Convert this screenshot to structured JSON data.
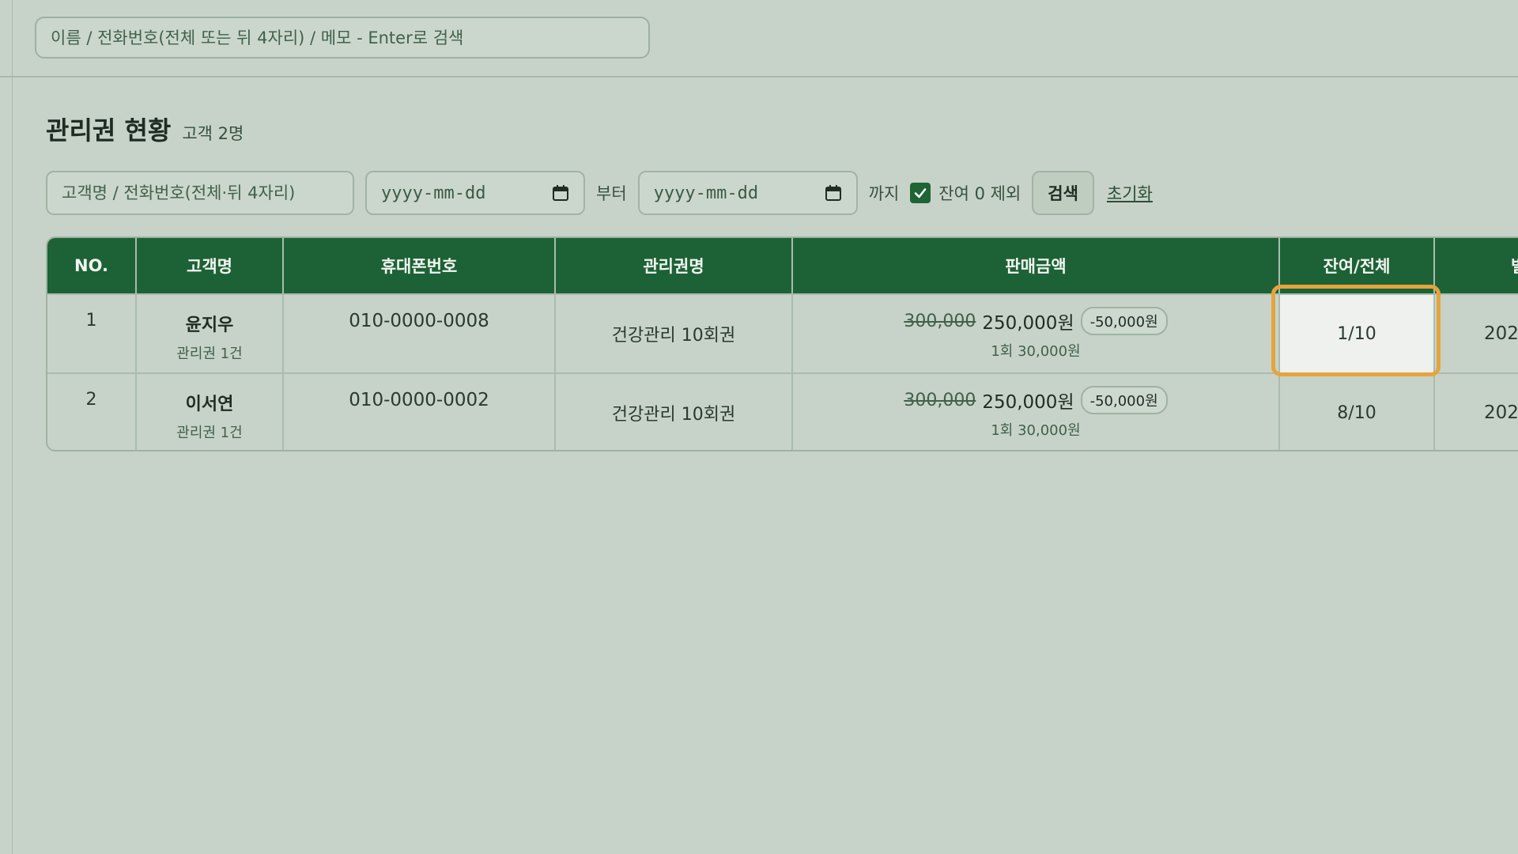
{
  "global_search": {
    "placeholder": "이름 / 전화번호(전체 또는 뒤 4자리) / 메모 - Enter로 검색"
  },
  "page": {
    "title": "관리권 현황",
    "customer_count": "고객 2명"
  },
  "filters": {
    "name_placeholder": "고객명 / 전화번호(전체·뒤 4자리)",
    "date_from_placeholder": "yyyy-mm-dd",
    "from_word": "부터",
    "date_to_placeholder": "yyyy-mm-dd",
    "to_word": "까지",
    "exclude_zero_checked": true,
    "exclude_zero_label": "잔여 0 제외",
    "search_button": "검색",
    "reset_link": "초기화"
  },
  "table": {
    "headers": [
      "NO.",
      "고객명",
      "휴대폰번호",
      "관리권명",
      "판매금액",
      "잔여/전체",
      "별"
    ],
    "rows": [
      {
        "no": "1",
        "name": "윤지우",
        "sub": "관리권 1건",
        "phone": "010-0000-0008",
        "ticket": "건강관리 10회권",
        "orig_price": "300,000",
        "final_price": "250,000원",
        "discount": "-50,000원",
        "per_session": "1회 30,000원",
        "remaining": "1/10",
        "date_partial": "202",
        "highlighted": true
      },
      {
        "no": "2",
        "name": "이서연",
        "sub": "관리권 1건",
        "phone": "010-0000-0002",
        "ticket": "건강관리 10회권",
        "orig_price": "300,000",
        "final_price": "250,000원",
        "discount": "-50,000원",
        "per_session": "1회 30,000원",
        "remaining": "8/10",
        "date_partial": "202",
        "highlighted": false
      }
    ]
  },
  "colors": {
    "header_bg": "#1d6236",
    "highlight": "#e6a43b",
    "page_bg": "#c7d3c8"
  }
}
